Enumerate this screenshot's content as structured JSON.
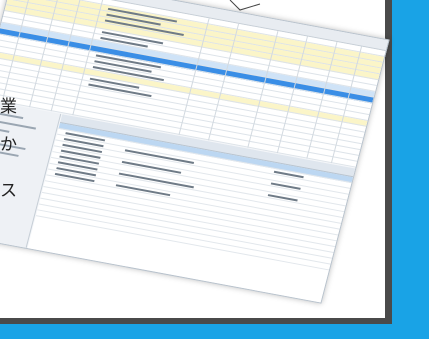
{
  "side_text": {
    "line1": "業",
    "line2": "か",
    "line3": "ス"
  },
  "colors": {
    "accent_blue": "#19a3e6",
    "shadow": "#4a4a4a",
    "row_highlight_yellow": "#fbf5c8",
    "row_selected_blue": "#3a8ee6",
    "toolbar_green": "#5cb85c"
  },
  "screenshot": {
    "description_icon": "spreadsheet-window-icon"
  }
}
